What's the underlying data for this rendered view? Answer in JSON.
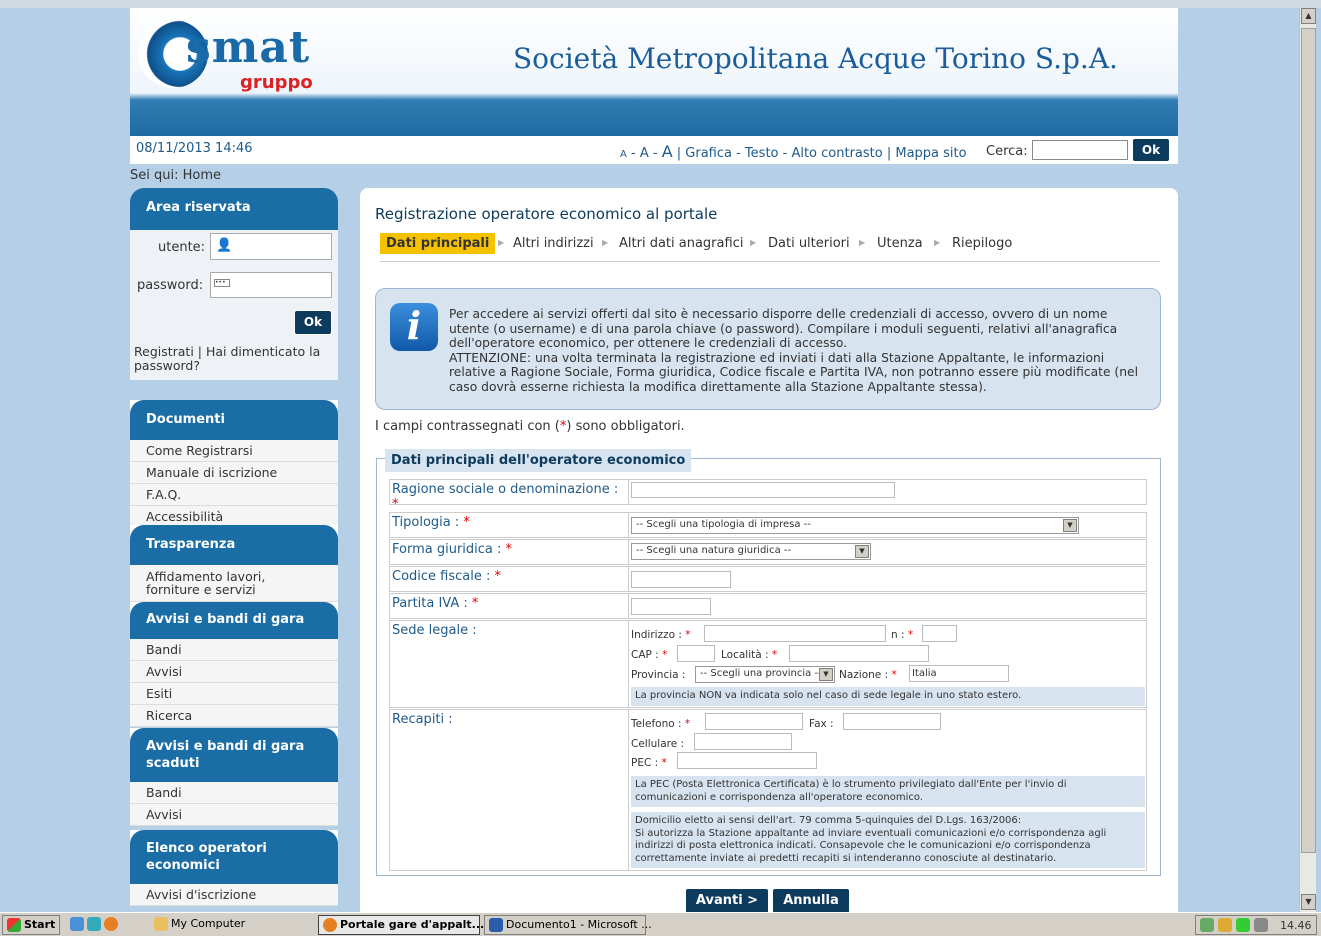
{
  "header": {
    "logo_word": "smat",
    "logo_sub": "gruppo",
    "site_title": "Società Metropolitana Acque Torino S.p.A."
  },
  "topbar": {
    "datetime": "08/11/2013 14:46",
    "font_small": "A",
    "font_medium": "A",
    "font_large": "A",
    "links": "| Grafica - Testo - Alto contrasto | Mappa sito",
    "search_label": "Cerca:",
    "search_ok": "Ok"
  },
  "breadcrumb": "Sei qui: Home",
  "login": {
    "title": "Area riservata",
    "user_label": "utente:",
    "password_label": "password:",
    "ok": "Ok",
    "links": "Registrati | Hai dimenticato la password?"
  },
  "sidebar": {
    "documenti": {
      "title": "Documenti",
      "items": [
        "Come Registrarsi",
        "Manuale di iscrizione",
        "F.A.Q.",
        "Accessibilità"
      ]
    },
    "trasparenza": {
      "title": "Trasparenza",
      "items": [
        "Affidamento lavori, forniture e servizi"
      ]
    },
    "avvisi": {
      "title": "Avvisi e bandi di gara",
      "items": [
        "Bandi",
        "Avvisi",
        "Esiti",
        "Ricerca"
      ]
    },
    "scaduti": {
      "title": "Avvisi e bandi di gara scaduti",
      "items": [
        "Bandi",
        "Avvisi"
      ]
    },
    "elenco": {
      "title": "Elenco operatori economici",
      "items": [
        "Avvisi d'iscrizione"
      ]
    }
  },
  "main": {
    "title": "Registrazione operatore economico al portale",
    "steps": [
      "Dati principali",
      "Altri indirizzi",
      "Altri dati anagrafici",
      "Dati ulteriori",
      "Utenza",
      "Riepilogo"
    ],
    "info_text": "Per accedere ai servizi offerti dal sito è necessario disporre delle credenziali di accesso, ovvero di un nome utente (o username) e di una parola chiave (o password). Compilare i moduli seguenti, relativi all'anagrafica dell'operatore economico, per ottenere le credenziali di accesso.\nATTENZIONE: una volta terminata la registrazione ed inviati i dati alla Stazione Appaltante, le informazioni relative a Ragione Sociale, Forma giuridica, Codice fiscale e Partita IVA, non potranno essere più modificate (nel caso dovrà esserne richiesta la modifica direttamente alla Stazione Appaltante stessa).",
    "required_note_pre": "I campi contrassegnati con (",
    "required_star": "*",
    "required_note_post": ") sono obbligatori.",
    "legend": "Dati principali dell'operatore economico",
    "labels": {
      "ragione": "Ragione sociale o denominazione :",
      "tipologia": "Tipologia :",
      "forma": "Forma giuridica :",
      "codice": "Codice fiscale :",
      "partita": "Partita IVA :",
      "sede": "Sede legale :",
      "recapiti": "Recapiti :"
    },
    "tipologia_select": "-- Scegli una tipologia di impresa --",
    "forma_select": "-- Scegli una natura giuridica --",
    "sede": {
      "indirizzo": "Indirizzo :",
      "n": "n :",
      "cap": "CAP :",
      "localita": "Località :",
      "provincia": "Provincia :",
      "provincia_select": "-- Scegli una provincia --",
      "nazione": "Nazione :",
      "nazione_value": "Italia",
      "note": "La provincia NON va indicata solo nel caso di sede legale in uno stato estero."
    },
    "recapiti": {
      "telefono": "Telefono :",
      "fax": "Fax :",
      "cellulare": "Cellulare :",
      "pec": "PEC :",
      "pec_note": "La PEC (Posta Elettronica Certificata) è lo strumento privilegiato dall'Ente per l'invio di\ncomunicazioni e corrispondenza all'operatore economico.",
      "domicilio_note": "Domicilio eletto ai sensi dell'art. 79 comma 5-quinquies del D.Lgs. 163/2006:\nSi autorizza la Stazione appaltante ad inviare eventuali comunicazioni e/o corrispondenza agli\nindirizzi di posta elettronica indicati. Consapevole che le comunicazioni e/o corrispondenza\ncorrettamente inviate ai predetti recapiti si intenderanno conosciute al destinatario."
    },
    "btn_next": "Avanti >",
    "btn_cancel": "Annulla"
  },
  "taskbar": {
    "start": "Start",
    "mycomputer": "My Computer",
    "task1": "Portale gare d'appalt...",
    "task2": "Documento1 - Microsoft ...",
    "clock": "14.46"
  }
}
